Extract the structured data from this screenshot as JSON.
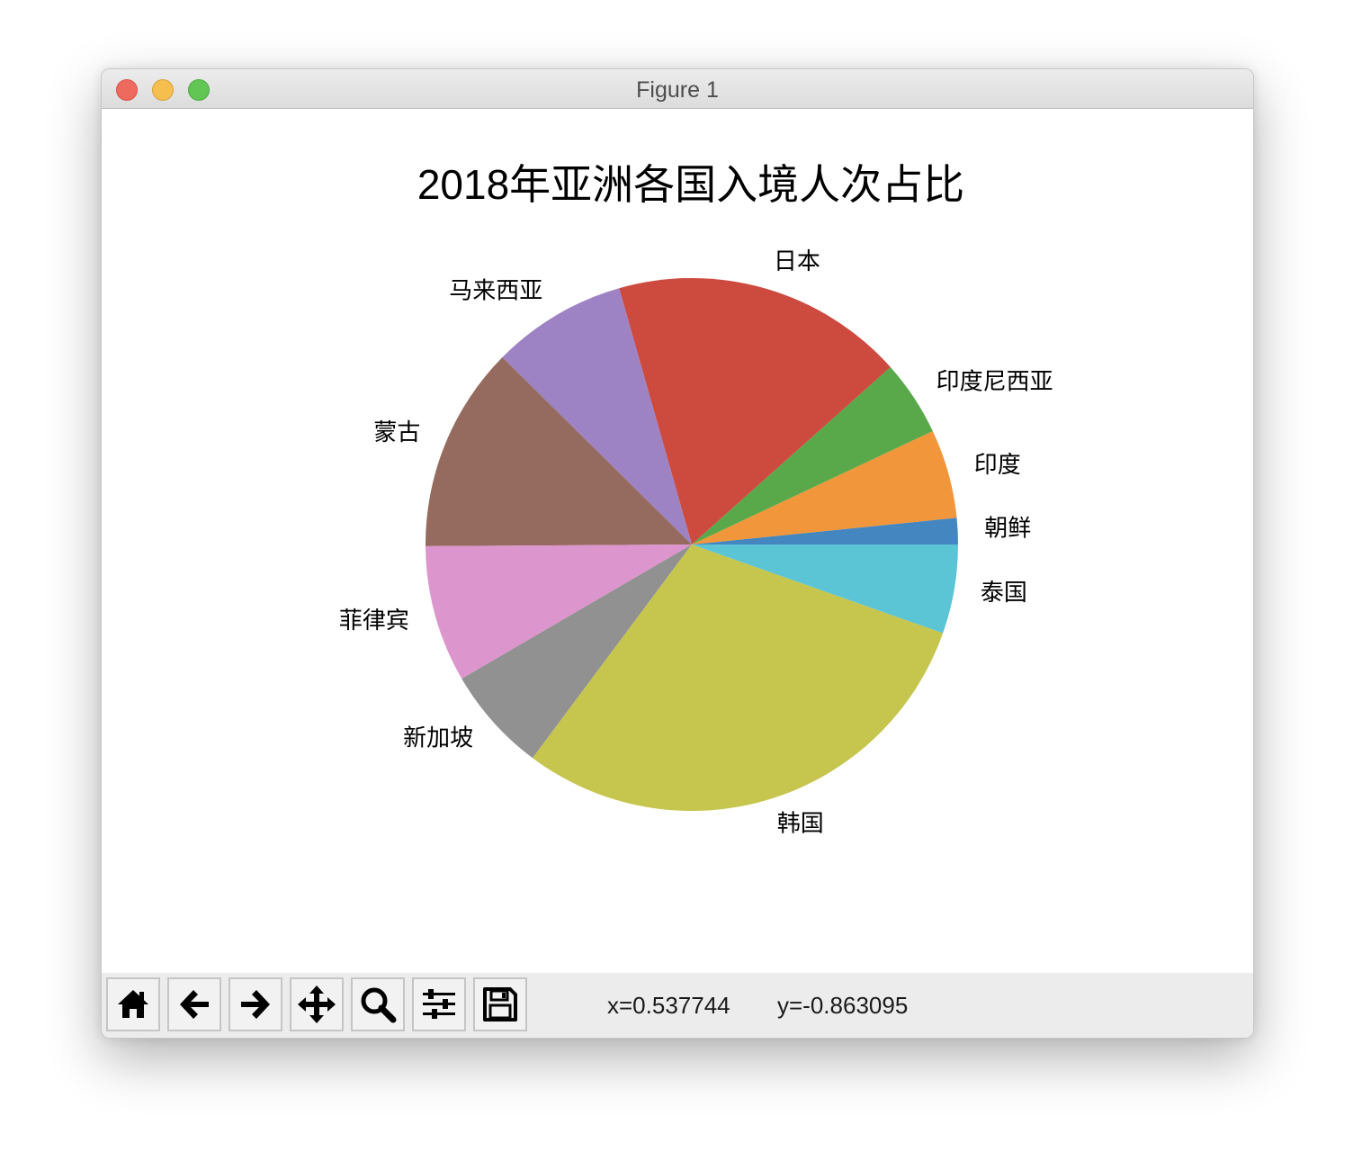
{
  "window": {
    "title": "Figure 1"
  },
  "toolbar": {
    "buttons": [
      {
        "name": "home",
        "icon": "home-icon"
      },
      {
        "name": "back",
        "icon": "arrow-left-icon"
      },
      {
        "name": "forward",
        "icon": "arrow-right-icon"
      },
      {
        "name": "pan",
        "icon": "move-icon"
      },
      {
        "name": "zoom",
        "icon": "magnifier-icon"
      },
      {
        "name": "configure-subplots",
        "icon": "sliders-icon"
      },
      {
        "name": "save",
        "icon": "floppy-disk-icon"
      }
    ],
    "coord_x": "x=0.537744",
    "coord_y": "y=-0.863095"
  },
  "chart_data": {
    "type": "pie",
    "title": "2018年亚洲各国入境人次占比",
    "start_angle_deg": 0,
    "direction": "counterclockwise",
    "legend": "none",
    "slices": [
      {
        "label": "朝鲜",
        "value": 1.6,
        "color": "#4486c0"
      },
      {
        "label": "印度",
        "value": 5.4,
        "color": "#f1963a"
      },
      {
        "label": "印度尼西亚",
        "value": 4.6,
        "color": "#59a94a"
      },
      {
        "label": "日本",
        "value": 17.8,
        "color": "#cd4a3f"
      },
      {
        "label": "马来西亚",
        "value": 8.2,
        "color": "#9e83c4"
      },
      {
        "label": "蒙古",
        "value": 12.5,
        "color": "#966b5f"
      },
      {
        "label": "菲律宾",
        "value": 8.3,
        "color": "#dd95cd"
      },
      {
        "label": "新加坡",
        "value": 6.4,
        "color": "#919191"
      },
      {
        "label": "韩国",
        "value": 29.8,
        "color": "#c6c54e"
      },
      {
        "label": "泰国",
        "value": 5.4,
        "color": "#5bc5d6"
      }
    ]
  }
}
